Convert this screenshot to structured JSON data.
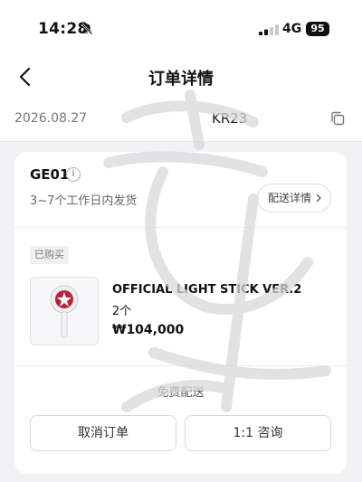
{
  "status_bar": {
    "time": "14:28",
    "network": "4G",
    "battery": "95"
  },
  "nav": {
    "title": "订单详情"
  },
  "order": {
    "date": "2026.08.27",
    "number_prefix": "KR23"
  },
  "seller": {
    "name": "GE01",
    "info_glyph": "i",
    "shipping_time": "3~7个工作日内发货",
    "shipping_detail_label": "配送详情"
  },
  "item": {
    "badge": "已购买",
    "name": "OFFICIAL LIGHT STICK VER.2",
    "quantity": "2个",
    "price": "₩104,000"
  },
  "footer": {
    "shipping_fee": "免费配送",
    "cancel_label": "取消订单",
    "consult_label": "1:1 咨询"
  },
  "icons": [
    "bell-slash-icon",
    "signal-icon",
    "back-arrow-icon",
    "copy-icon",
    "info-icon",
    "chevron-right-icon",
    "light-stick-image"
  ],
  "colors": {
    "background": "#f2f2f5",
    "card": "#ffffff",
    "text": "#111111",
    "muted": "#777777",
    "lightstick_accent": "#b8243a"
  }
}
